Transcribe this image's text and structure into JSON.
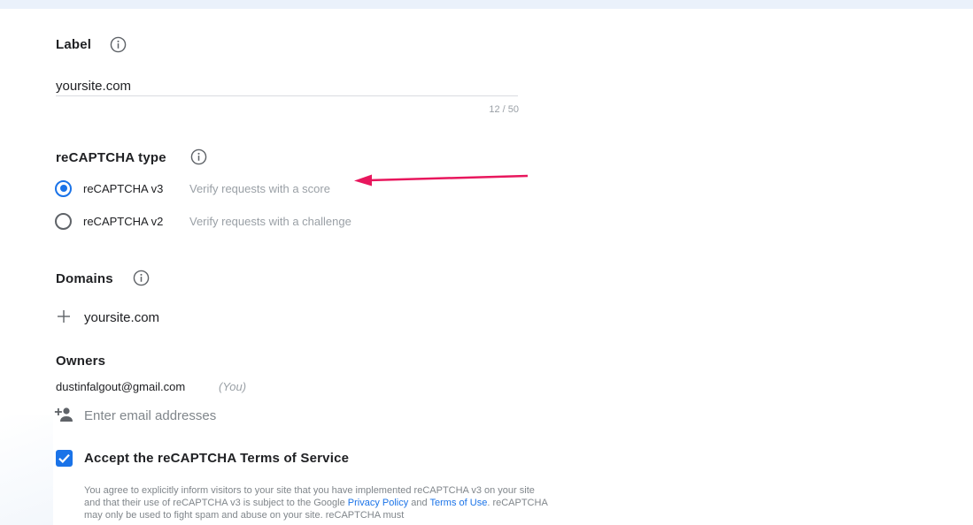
{
  "label_section": {
    "title": "Label",
    "input_value": "yoursite.com",
    "char_count": "12 / 50"
  },
  "recaptcha_type": {
    "title": "reCAPTCHA type",
    "options": [
      {
        "name": "reCAPTCHA v3",
        "description": "Verify requests with a score",
        "selected": true
      },
      {
        "name": "reCAPTCHA v2",
        "description": "Verify requests with a challenge",
        "selected": false
      }
    ]
  },
  "domains": {
    "title": "Domains",
    "items": [
      "yoursite.com"
    ]
  },
  "owners": {
    "title": "Owners",
    "email": "dustinfalgout@gmail.com",
    "you_tag": "(You)",
    "add_placeholder": "Enter email addresses"
  },
  "terms": {
    "checked": true,
    "title": "Accept the reCAPTCHA Terms of Service",
    "text_1": "You agree to explicitly inform visitors to your site that you have implemented reCAPTCHA v3 on your site and that their use of reCAPTCHA v3 is subject to the Google ",
    "privacy_link": "Privacy Policy",
    "text_2": " and ",
    "terms_link": "Terms of Use",
    "text_3": ". reCAPTCHA may only be used to fight spam and abuse on your site. reCAPTCHA must"
  },
  "colors": {
    "accent": "#1a73e8",
    "annotation_arrow": "#e8175d",
    "top_band": "#eaf1fb"
  },
  "icons": {
    "info": "info-circle-icon",
    "plus": "plus-icon",
    "add_person": "person-add-icon",
    "check": "check-icon"
  }
}
